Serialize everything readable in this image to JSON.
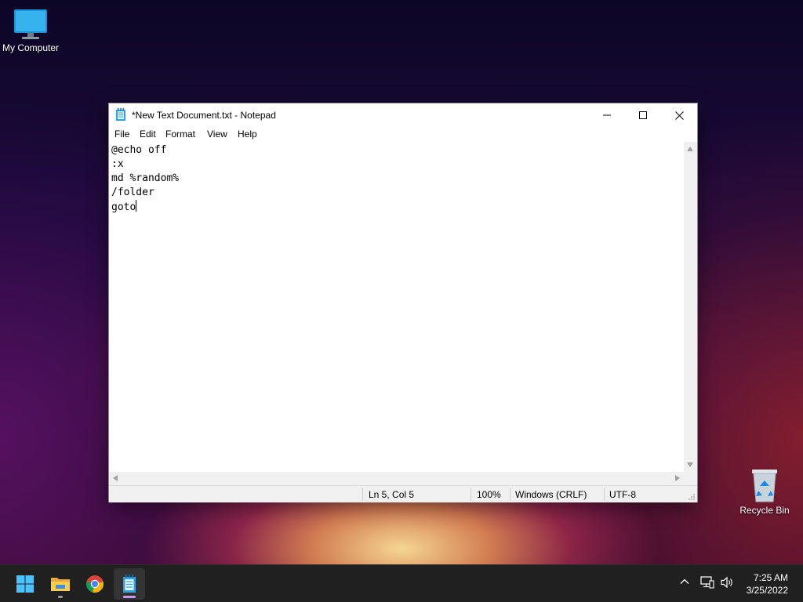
{
  "desktop": {
    "icons": [
      {
        "label": "My Computer",
        "icon": "monitor-icon"
      },
      {
        "label": "Recycle Bin",
        "icon": "recycle-bin-icon"
      }
    ]
  },
  "notepad": {
    "title": "*New Text Document.txt - Notepad",
    "menu": [
      "File",
      "Edit",
      "Format",
      "View",
      "Help"
    ],
    "content_lines": [
      "@echo off",
      ":x",
      "md %random%",
      "/folder",
      "goto"
    ],
    "status": {
      "position": "Ln 5, Col 5",
      "zoom": "100%",
      "line_ending": "Windows (CRLF)",
      "encoding": "UTF-8"
    }
  },
  "taskbar": {
    "apps": [
      "start-icon",
      "file-explorer-icon",
      "chrome-icon",
      "notepad-icon"
    ],
    "active_app": "notepad-icon",
    "tray": [
      "chevron-up-icon",
      "network-icon",
      "volume-icon"
    ],
    "clock": {
      "time": "7:25 AM",
      "date": "3/25/2022"
    }
  },
  "colors": {
    "accent": "#4cc2ff",
    "active_indicator": "#c79af4",
    "taskbar": "#202020"
  }
}
